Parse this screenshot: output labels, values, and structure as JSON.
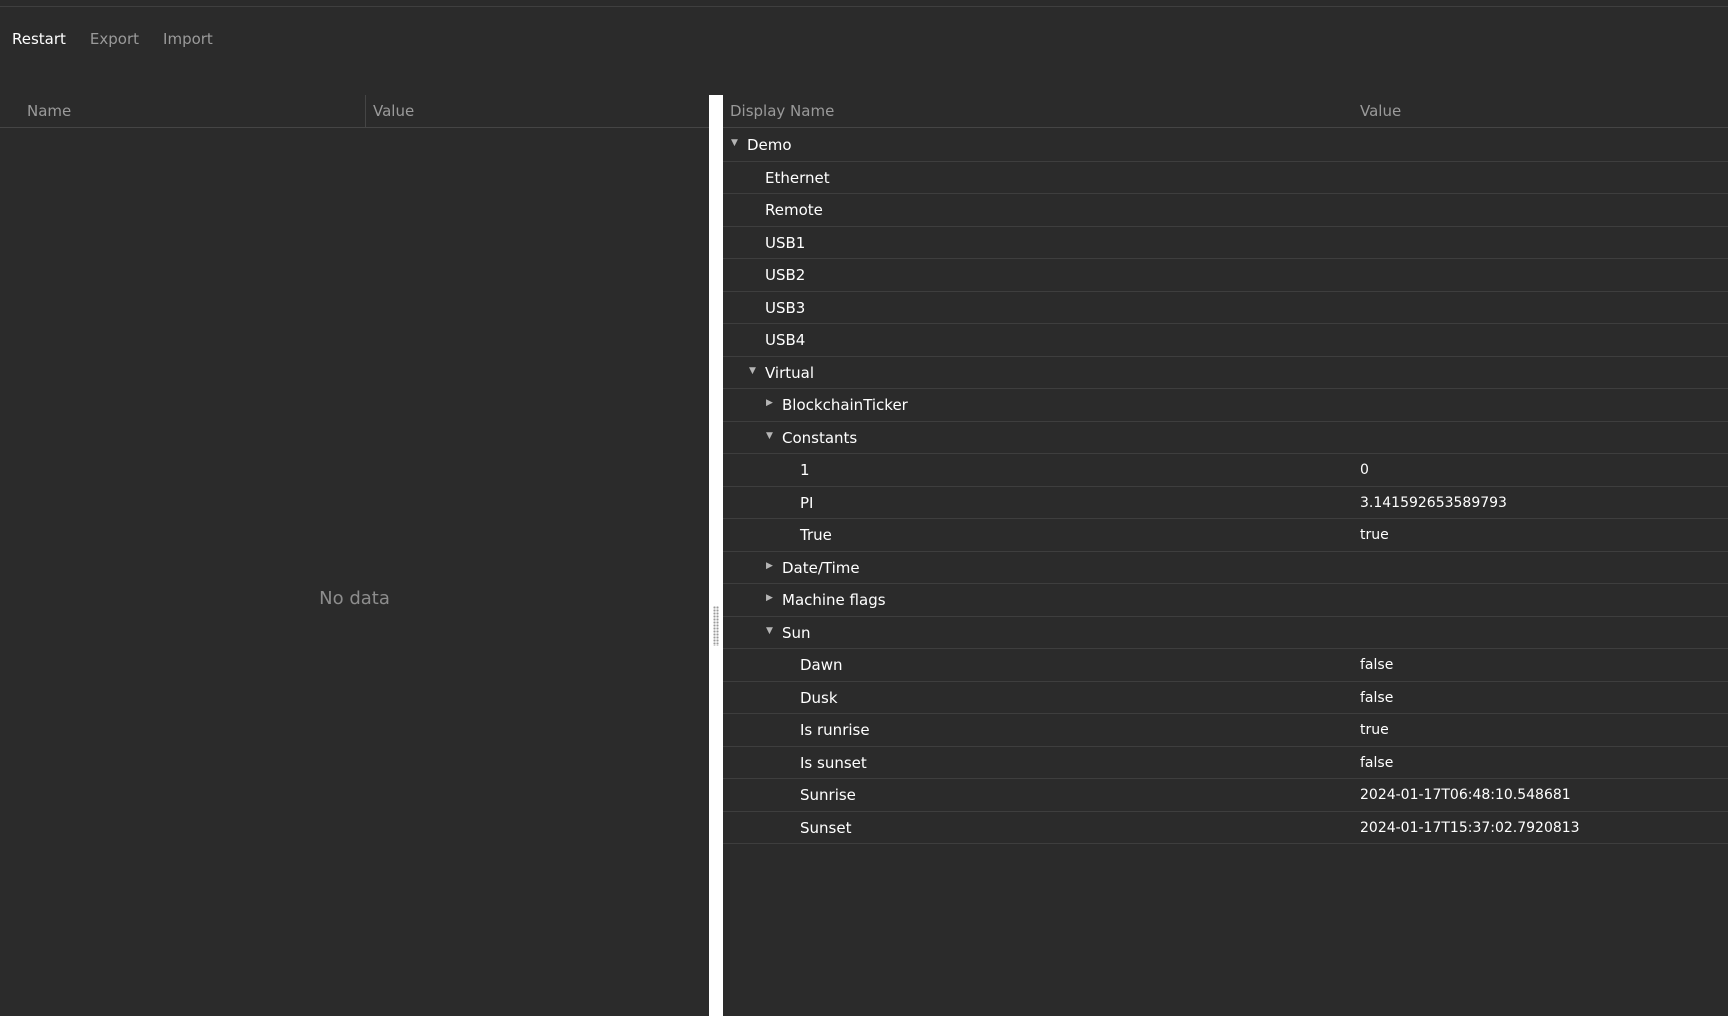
{
  "toolbar": {
    "restart": "Restart",
    "export": "Export",
    "import": "Import"
  },
  "left_pane": {
    "col_name": "Name",
    "col_value": "Value",
    "empty_text": "No data"
  },
  "right_pane": {
    "col_display_name": "Display Name",
    "col_value": "Value",
    "rows": [
      {
        "name": "Demo",
        "value": "",
        "expanded": true
      },
      {
        "name": "Ethernet",
        "value": ""
      },
      {
        "name": "Remote",
        "value": ""
      },
      {
        "name": "USB1",
        "value": ""
      },
      {
        "name": "USB2",
        "value": ""
      },
      {
        "name": "USB3",
        "value": ""
      },
      {
        "name": "USB4",
        "value": ""
      },
      {
        "name": "Virtual",
        "value": "",
        "expanded": true
      },
      {
        "name": "BlockchainTicker",
        "value": "",
        "expanded": false
      },
      {
        "name": "Constants",
        "value": "",
        "expanded": true
      },
      {
        "name": "1",
        "value": "0"
      },
      {
        "name": "PI",
        "value": "3.141592653589793"
      },
      {
        "name": "True",
        "value": "true"
      },
      {
        "name": "Date/Time",
        "value": "",
        "expanded": false
      },
      {
        "name": "Machine flags",
        "value": "",
        "expanded": false
      },
      {
        "name": "Sun",
        "value": "",
        "expanded": true
      },
      {
        "name": "Dawn",
        "value": "false"
      },
      {
        "name": "Dusk",
        "value": "false"
      },
      {
        "name": "Is runrise",
        "value": "true"
      },
      {
        "name": "Is sunset",
        "value": "false"
      },
      {
        "name": "Sunrise",
        "value": "2024-01-17T06:48:10.548681"
      },
      {
        "name": "Sunset",
        "value": "2024-01-17T15:37:02.7920813"
      }
    ]
  },
  "icons": {
    "expanded": "caret-down-icon",
    "collapsed": "caret-right-icon",
    "splitter": "drag-grip-icon"
  }
}
